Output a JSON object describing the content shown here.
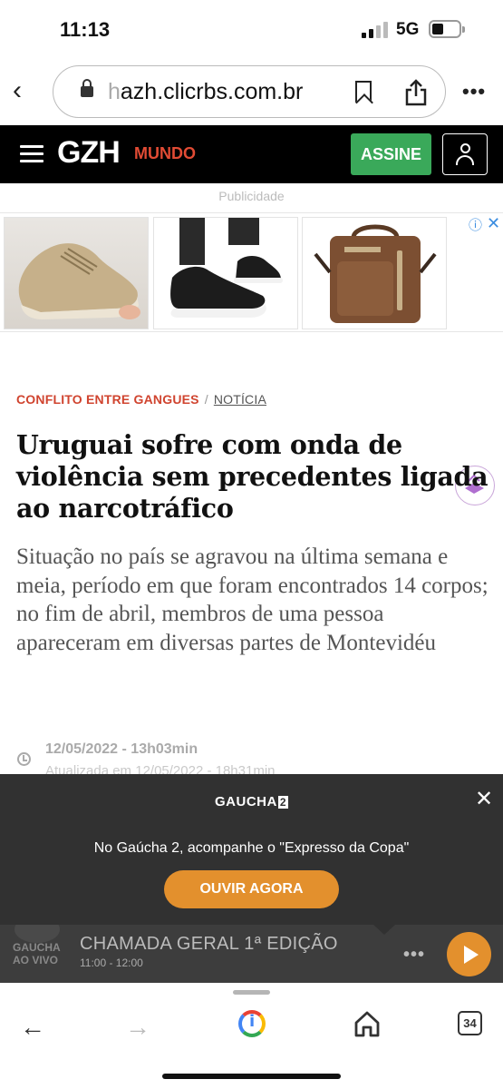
{
  "status_bar": {
    "time": "11:13",
    "network": "5G"
  },
  "browser": {
    "url_faded": "h",
    "url": "azh.clicrbs.com.br",
    "tab_count": "34"
  },
  "site": {
    "logo": "GZH",
    "section": "MUNDO",
    "subscribe_label": "ASSINE"
  },
  "ad": {
    "label": "Publicidade"
  },
  "article": {
    "category": "CONFLITO ENTRE GANGUES",
    "separator": "/",
    "type": "NOTÍCIA",
    "headline": "Uruguai sofre com onda de violência sem precedentes ligada ao narcotráfico",
    "lede": "Situação no país se agravou na última semana e meia, período em que foram encontrados 14 corpos; no fim de abril, membros de uma pessoa apareceram em diversas partes de Montevidéu",
    "date": "12/05/2022 - 13h03min",
    "updated": "Atualizada em 12/05/2022 - 18h31min"
  },
  "radio": {
    "logo_text": "GAUCHA",
    "logo_number": "2",
    "message": "No Gaúcha 2, acompanhe o \"Expresso da Copa\"",
    "cta_label": "OUVIR AGORA",
    "live_line1": "GAUCHA",
    "live_line2": "AO VIVO",
    "program": "CHAMADA GERAL 1ª EDIÇÃO",
    "program_time": "11:00 - 12:00"
  },
  "colors": {
    "brand_red": "#e14b34",
    "subscribe_green": "#3aa95a",
    "radio_orange": "#e3902d"
  }
}
